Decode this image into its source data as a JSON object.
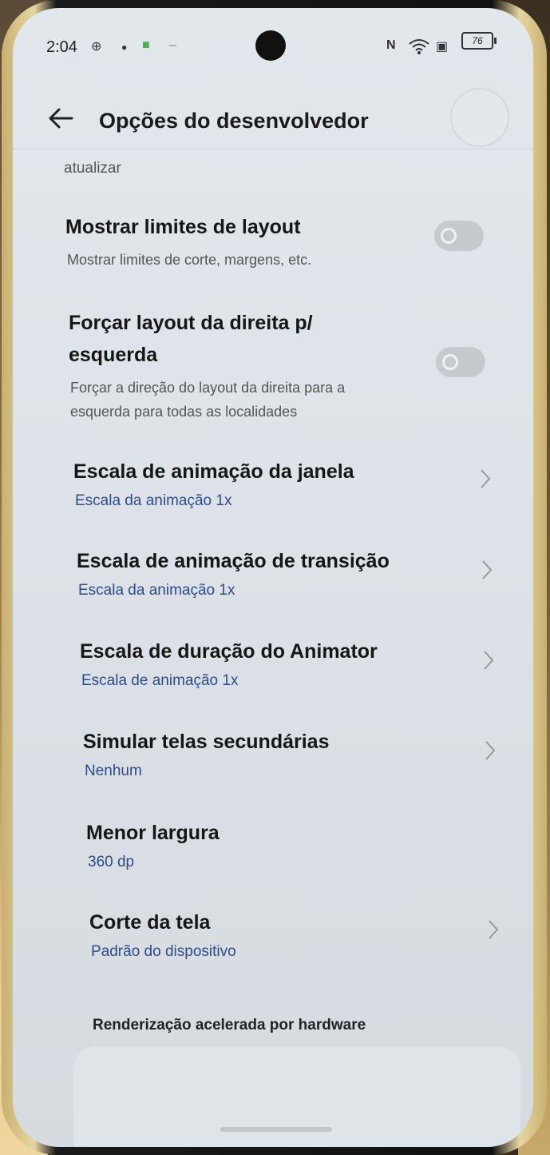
{
  "status_bar": {
    "time": "2:04",
    "battery": "76"
  },
  "header": {
    "title": "Opções do desenvolvedor"
  },
  "prev_item_tail": "atualizar",
  "items": [
    {
      "title": "Mostrar limites de layout",
      "subtitle": "Mostrar limites de corte, margens, etc.",
      "type": "toggle",
      "enabled": false
    },
    {
      "title_line1": "Forçar layout da direita p/",
      "title_line2": "esquerda",
      "subtitle_line1": "Forçar a direção do layout da direita para a",
      "subtitle_line2": "esquerda para todas as localidades",
      "type": "toggle",
      "enabled": false
    },
    {
      "title": "Escala de animação da janela",
      "value": "Escala da animação 1x",
      "type": "chevron"
    },
    {
      "title": "Escala de animação de transição",
      "value": "Escala da animação 1x",
      "type": "chevron"
    },
    {
      "title": "Escala de duração do Animator",
      "value": "Escala de animação 1x",
      "type": "chevron"
    },
    {
      "title": "Simular telas secundárias",
      "value": "Nenhum",
      "type": "chevron"
    },
    {
      "title": "Menor largura",
      "value": "360 dp",
      "type": "static"
    },
    {
      "title": "Corte da tela",
      "value": "Padrão do dispositivo",
      "type": "chevron"
    }
  ],
  "section": {
    "header": "Renderização acelerada por hardware"
  },
  "colors": {
    "accent_value_text": "#2f4c8a",
    "toggle_off": "#c5cacf"
  }
}
